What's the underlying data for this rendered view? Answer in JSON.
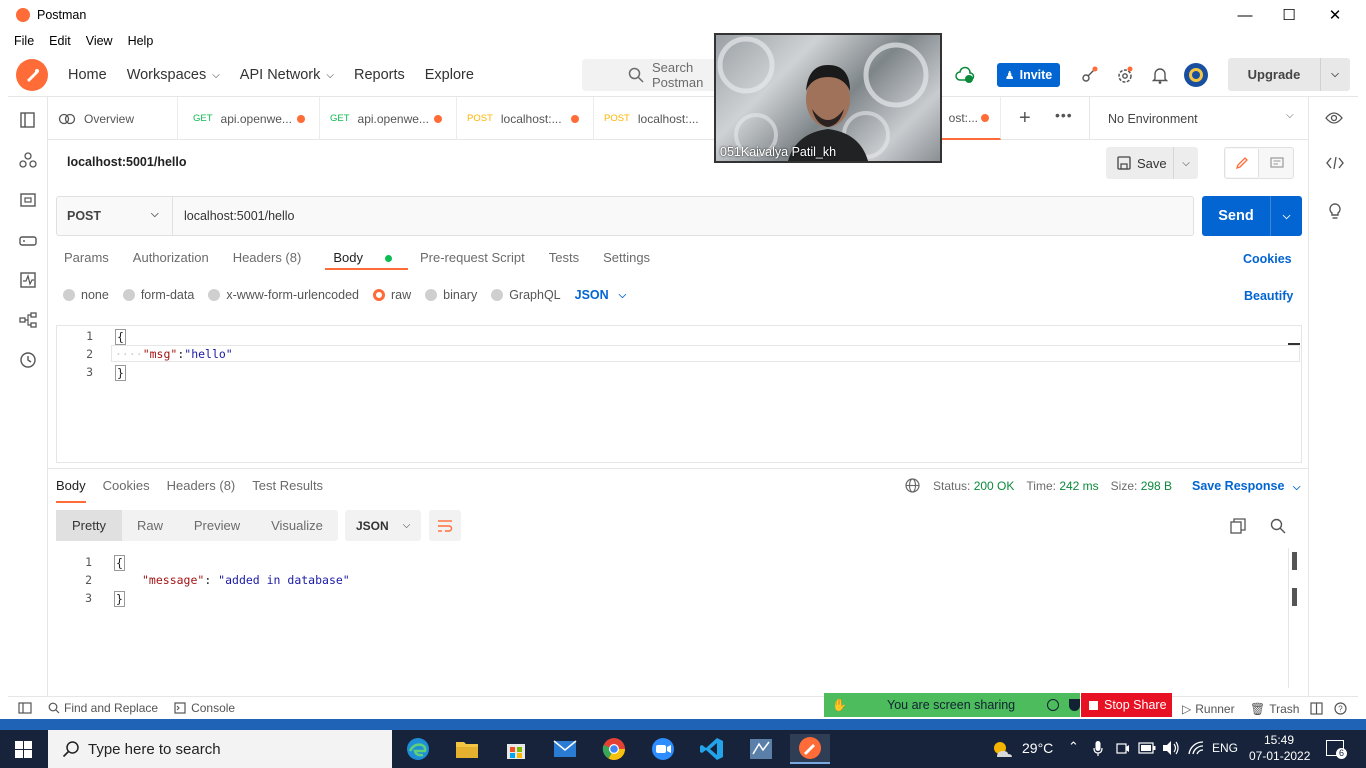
{
  "window": {
    "title": "Postman",
    "minimize": "—",
    "maximize": "☐",
    "close": "✕"
  },
  "menu": [
    "File",
    "Edit",
    "View",
    "Help"
  ],
  "nav": {
    "home": "Home",
    "workspaces": "Workspaces",
    "api_network": "API Network",
    "reports": "Reports",
    "explore": "Explore",
    "search_placeholder": "Search Postman",
    "invite": "Invite",
    "upgrade": "Upgrade"
  },
  "tabs": [
    {
      "method": "",
      "label": "Overview"
    },
    {
      "method": "GET",
      "label": "api.openwe..."
    },
    {
      "method": "GET",
      "label": "api.openwe..."
    },
    {
      "method": "POST",
      "label": "localhost:..."
    },
    {
      "method": "POST",
      "label": "localhost:..."
    },
    {
      "method": "",
      "label": "ost:..."
    }
  ],
  "environment": "No Environment",
  "request": {
    "title": "localhost:5001/hello",
    "save": "Save",
    "method": "POST",
    "url": "localhost:5001/hello",
    "send": "Send",
    "tabs": [
      "Params",
      "Authorization",
      "Headers (8)",
      "Body",
      "Pre-request Script",
      "Tests",
      "Settings"
    ],
    "cookies": "Cookies",
    "body_types": [
      "none",
      "form-data",
      "x-www-form-urlencoded",
      "raw",
      "binary",
      "GraphQL"
    ],
    "body_format": "JSON",
    "beautify": "Beautify",
    "code_lines": [
      {
        "n": "1",
        "text": "{"
      },
      {
        "n": "2",
        "key": "\"msg\"",
        "sep": ":",
        "val": "\"hello\""
      },
      {
        "n": "3",
        "text": "}"
      }
    ]
  },
  "response": {
    "tabs": [
      "Body",
      "Cookies",
      "Headers (8)",
      "Test Results"
    ],
    "status_label": "Status:",
    "status_value": "200 OK",
    "time_label": "Time:",
    "time_value": "242 ms",
    "size_label": "Size:",
    "size_value": "298 B",
    "save_response": "Save Response",
    "views": [
      "Pretty",
      "Raw",
      "Preview",
      "Visualize"
    ],
    "format": "JSON",
    "code_lines": [
      {
        "n": "1",
        "text": "{"
      },
      {
        "n": "2",
        "key": "\"message\"",
        "sep": ": ",
        "val": "\"added in database\""
      },
      {
        "n": "3",
        "text": "}"
      }
    ]
  },
  "footer": {
    "find_replace": "Find and Replace",
    "console": "Console",
    "runner": "Runner",
    "trash": "Trash"
  },
  "screen_share": {
    "message": "You are screen sharing",
    "stop": "Stop Share"
  },
  "video": {
    "participant": "051Kaivalya Patil_kh"
  },
  "taskbar": {
    "search_placeholder": "Type here to search",
    "temperature": "29°C",
    "language": "ENG",
    "time": "15:49",
    "date": "07-01-2022",
    "notifications": "6"
  },
  "colors": {
    "accent": "#ff6c37",
    "primary": "#0265d2",
    "success": "#0b8a3c"
  }
}
